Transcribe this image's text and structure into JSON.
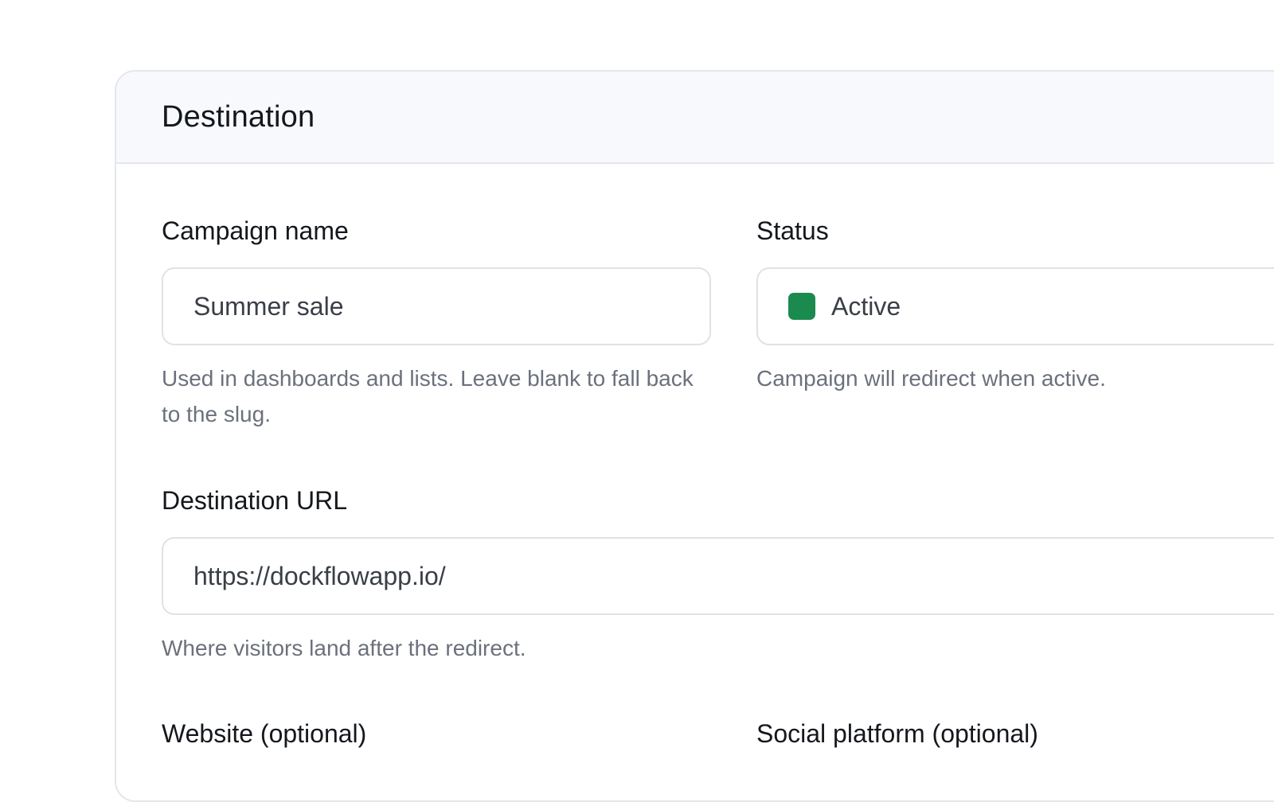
{
  "card": {
    "title": "Destination"
  },
  "campaign_name": {
    "label": "Campaign name",
    "value": "Summer sale",
    "help": "Used in dashboards and lists. Leave blank to fall back to the slug."
  },
  "status": {
    "label": "Status",
    "value": "Active",
    "indicator_color": "#1b8a4e",
    "help": "Campaign will redirect when active."
  },
  "destination_url": {
    "label": "Destination URL",
    "value": "https://dockflowapp.io/",
    "help": "Where visitors land after the redirect."
  },
  "website": {
    "label": "Website (optional)"
  },
  "social_platform": {
    "label": "Social platform (optional)"
  }
}
